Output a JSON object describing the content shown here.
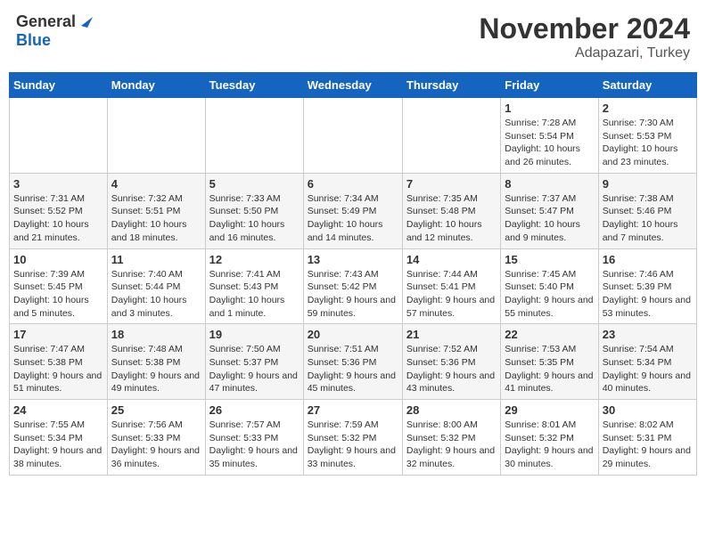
{
  "header": {
    "logo_general": "General",
    "logo_blue": "Blue",
    "month": "November 2024",
    "location": "Adapazari, Turkey"
  },
  "days_of_week": [
    "Sunday",
    "Monday",
    "Tuesday",
    "Wednesday",
    "Thursday",
    "Friday",
    "Saturday"
  ],
  "weeks": [
    [
      {
        "day": "",
        "info": ""
      },
      {
        "day": "",
        "info": ""
      },
      {
        "day": "",
        "info": ""
      },
      {
        "day": "",
        "info": ""
      },
      {
        "day": "",
        "info": ""
      },
      {
        "day": "1",
        "info": "Sunrise: 7:28 AM\nSunset: 5:54 PM\nDaylight: 10 hours and 26 minutes."
      },
      {
        "day": "2",
        "info": "Sunrise: 7:30 AM\nSunset: 5:53 PM\nDaylight: 10 hours and 23 minutes."
      }
    ],
    [
      {
        "day": "3",
        "info": "Sunrise: 7:31 AM\nSunset: 5:52 PM\nDaylight: 10 hours and 21 minutes."
      },
      {
        "day": "4",
        "info": "Sunrise: 7:32 AM\nSunset: 5:51 PM\nDaylight: 10 hours and 18 minutes."
      },
      {
        "day": "5",
        "info": "Sunrise: 7:33 AM\nSunset: 5:50 PM\nDaylight: 10 hours and 16 minutes."
      },
      {
        "day": "6",
        "info": "Sunrise: 7:34 AM\nSunset: 5:49 PM\nDaylight: 10 hours and 14 minutes."
      },
      {
        "day": "7",
        "info": "Sunrise: 7:35 AM\nSunset: 5:48 PM\nDaylight: 10 hours and 12 minutes."
      },
      {
        "day": "8",
        "info": "Sunrise: 7:37 AM\nSunset: 5:47 PM\nDaylight: 10 hours and 9 minutes."
      },
      {
        "day": "9",
        "info": "Sunrise: 7:38 AM\nSunset: 5:46 PM\nDaylight: 10 hours and 7 minutes."
      }
    ],
    [
      {
        "day": "10",
        "info": "Sunrise: 7:39 AM\nSunset: 5:45 PM\nDaylight: 10 hours and 5 minutes."
      },
      {
        "day": "11",
        "info": "Sunrise: 7:40 AM\nSunset: 5:44 PM\nDaylight: 10 hours and 3 minutes."
      },
      {
        "day": "12",
        "info": "Sunrise: 7:41 AM\nSunset: 5:43 PM\nDaylight: 10 hours and 1 minute."
      },
      {
        "day": "13",
        "info": "Sunrise: 7:43 AM\nSunset: 5:42 PM\nDaylight: 9 hours and 59 minutes."
      },
      {
        "day": "14",
        "info": "Sunrise: 7:44 AM\nSunset: 5:41 PM\nDaylight: 9 hours and 57 minutes."
      },
      {
        "day": "15",
        "info": "Sunrise: 7:45 AM\nSunset: 5:40 PM\nDaylight: 9 hours and 55 minutes."
      },
      {
        "day": "16",
        "info": "Sunrise: 7:46 AM\nSunset: 5:39 PM\nDaylight: 9 hours and 53 minutes."
      }
    ],
    [
      {
        "day": "17",
        "info": "Sunrise: 7:47 AM\nSunset: 5:38 PM\nDaylight: 9 hours and 51 minutes."
      },
      {
        "day": "18",
        "info": "Sunrise: 7:48 AM\nSunset: 5:38 PM\nDaylight: 9 hours and 49 minutes."
      },
      {
        "day": "19",
        "info": "Sunrise: 7:50 AM\nSunset: 5:37 PM\nDaylight: 9 hours and 47 minutes."
      },
      {
        "day": "20",
        "info": "Sunrise: 7:51 AM\nSunset: 5:36 PM\nDaylight: 9 hours and 45 minutes."
      },
      {
        "day": "21",
        "info": "Sunrise: 7:52 AM\nSunset: 5:36 PM\nDaylight: 9 hours and 43 minutes."
      },
      {
        "day": "22",
        "info": "Sunrise: 7:53 AM\nSunset: 5:35 PM\nDaylight: 9 hours and 41 minutes."
      },
      {
        "day": "23",
        "info": "Sunrise: 7:54 AM\nSunset: 5:34 PM\nDaylight: 9 hours and 40 minutes."
      }
    ],
    [
      {
        "day": "24",
        "info": "Sunrise: 7:55 AM\nSunset: 5:34 PM\nDaylight: 9 hours and 38 minutes."
      },
      {
        "day": "25",
        "info": "Sunrise: 7:56 AM\nSunset: 5:33 PM\nDaylight: 9 hours and 36 minutes."
      },
      {
        "day": "26",
        "info": "Sunrise: 7:57 AM\nSunset: 5:33 PM\nDaylight: 9 hours and 35 minutes."
      },
      {
        "day": "27",
        "info": "Sunrise: 7:59 AM\nSunset: 5:32 PM\nDaylight: 9 hours and 33 minutes."
      },
      {
        "day": "28",
        "info": "Sunrise: 8:00 AM\nSunset: 5:32 PM\nDaylight: 9 hours and 32 minutes."
      },
      {
        "day": "29",
        "info": "Sunrise: 8:01 AM\nSunset: 5:32 PM\nDaylight: 9 hours and 30 minutes."
      },
      {
        "day": "30",
        "info": "Sunrise: 8:02 AM\nSunset: 5:31 PM\nDaylight: 9 hours and 29 minutes."
      }
    ]
  ]
}
